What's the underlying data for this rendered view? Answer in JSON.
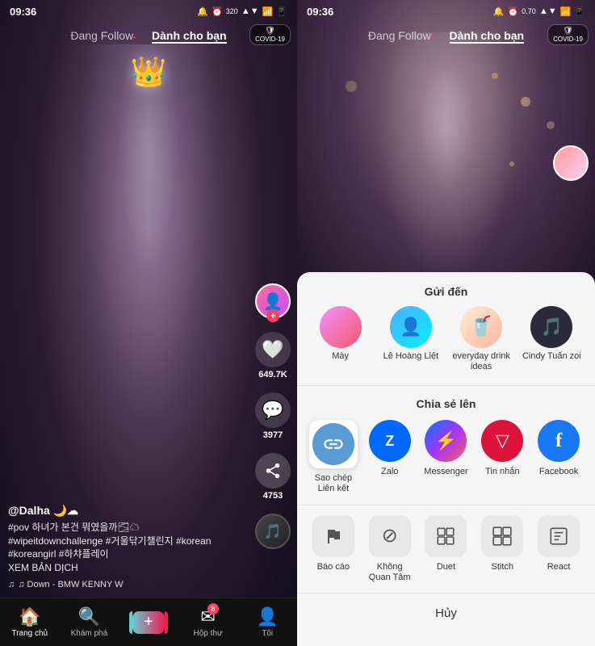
{
  "left": {
    "status_time": "09:36",
    "status_icons": "🔔 ⏰ 320 ▲ 📶 📶 📱",
    "nav": {
      "following": "Đang Follow",
      "for_you": "Dành cho bạn",
      "dot": "•"
    },
    "covid_badge": "COVID-19",
    "actions": {
      "likes": "649.7K",
      "comments": "3977",
      "shares": "4753"
    },
    "video_info": {
      "username": "@Dalha 🌙☁",
      "desc": "#pov 하녀가 본건 뭐였을까🌫☁\n#wipeitdownchallenge #거울닦기챌린지 #korean #koreangirl #하챠플레이\nXEM BẢN DỊCH",
      "music": "♫  Down - BMW KENNY  W"
    },
    "bottom_nav": {
      "home": "Trang chủ",
      "explore": "Khám phá",
      "inbox": "Hộp thư",
      "profile": "Tôi",
      "inbox_badge": "8"
    }
  },
  "right": {
    "status_time": "09:36",
    "nav": {
      "following": "Đang Follow",
      "for_you": "Dành cho bạn"
    },
    "covid_badge": "COVID-19",
    "bottom_sheet": {
      "send_to_title": "Gửi đến",
      "contacts": [
        {
          "name": "Mày",
          "avatar_type": "may"
        },
        {
          "name": "Lê Hoàng Liệt",
          "avatar_type": "le"
        },
        {
          "name": "everyday drink ideas",
          "avatar_type": "drink"
        },
        {
          "name": "Cindy Tuấn zoi",
          "avatar_type": "cindy"
        }
      ],
      "share_title": "Chia sẻ lên",
      "share_items": [
        {
          "label": "Sao chép Liên kết",
          "icon": "🔗",
          "type": "copy",
          "selected": true
        },
        {
          "label": "Zalo",
          "icon": "Z",
          "type": "zalo",
          "color": "#0068ff"
        },
        {
          "label": "Messenger",
          "icon": "💬",
          "type": "messenger",
          "color": "#0078ff"
        },
        {
          "label": "Tin nhắn",
          "icon": "✉",
          "type": "message",
          "color": "#dc143c"
        },
        {
          "label": "Facebook",
          "icon": "f",
          "type": "facebook",
          "color": "#1877f2"
        }
      ],
      "action_items": [
        {
          "label": "Báo cáo",
          "icon": "🚩"
        },
        {
          "label": "Không Quan Tâm",
          "icon": "🚫"
        },
        {
          "label": "Duet",
          "icon": "⊡"
        },
        {
          "label": "Stitch",
          "icon": "⊞"
        },
        {
          "label": "React",
          "icon": "📋"
        }
      ],
      "cancel": "Hủy"
    }
  }
}
